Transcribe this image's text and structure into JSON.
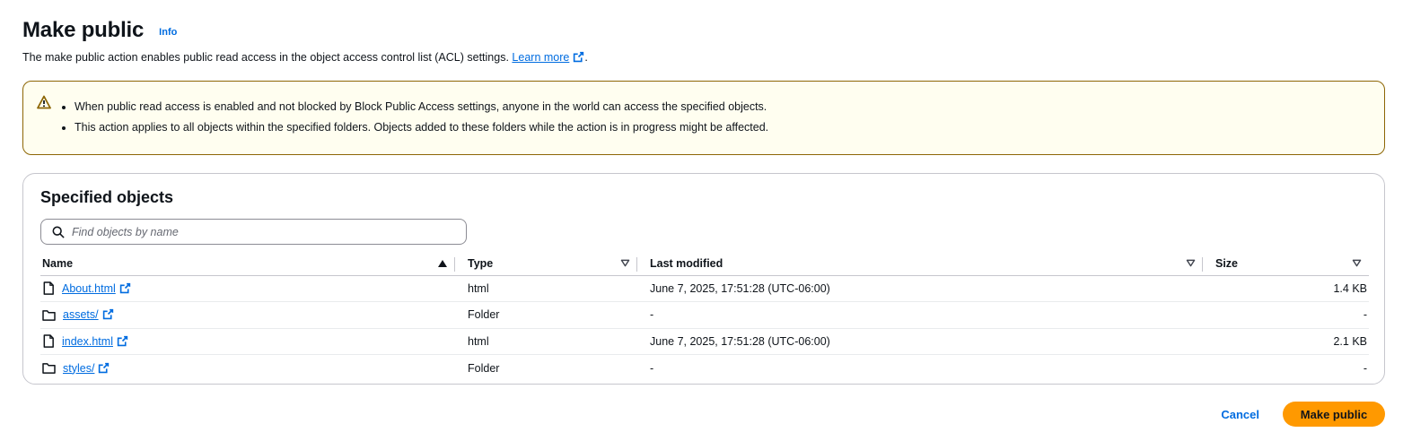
{
  "header": {
    "title": "Make public",
    "info": "Info",
    "description": "The make public action enables public read access in the object access control list (ACL) settings.",
    "learn_more": "Learn more",
    "period": "."
  },
  "alert": {
    "items": [
      "When public read access is enabled and not blocked by Block Public Access settings, anyone in the world can access the specified objects.",
      "This action applies to all objects within the specified folders. Objects added to these folders while the action is in progress might be affected."
    ]
  },
  "panel": {
    "title": "Specified objects",
    "search_placeholder": "Find objects by name",
    "columns": [
      "Name",
      "Type",
      "Last modified",
      "Size"
    ],
    "rows": [
      {
        "name": "About.html",
        "kind": "file",
        "type": "html",
        "modified": "June 7, 2025, 17:51:28 (UTC-06:00)",
        "size": "1.4 KB"
      },
      {
        "name": "assets/",
        "kind": "folder",
        "type": "Folder",
        "modified": "-",
        "size": "-"
      },
      {
        "name": "index.html",
        "kind": "file",
        "type": "html",
        "modified": "June 7, 2025, 17:51:28 (UTC-06:00)",
        "size": "2.1 KB"
      },
      {
        "name": "styles/",
        "kind": "folder",
        "type": "Folder",
        "modified": "-",
        "size": "-"
      }
    ]
  },
  "footer": {
    "cancel": "Cancel",
    "submit": "Make public"
  },
  "colors": {
    "link": "#006ce0",
    "primary": "#ff9900",
    "alert_border": "#8d6605",
    "alert_bg": "#fffef0"
  },
  "icons": {
    "external": "external-link-icon",
    "warning": "warning-icon",
    "search": "search-icon",
    "file": "file-icon",
    "folder": "folder-icon",
    "sort_asc": "sort-ascending-icon",
    "sort": "sort-icon"
  }
}
